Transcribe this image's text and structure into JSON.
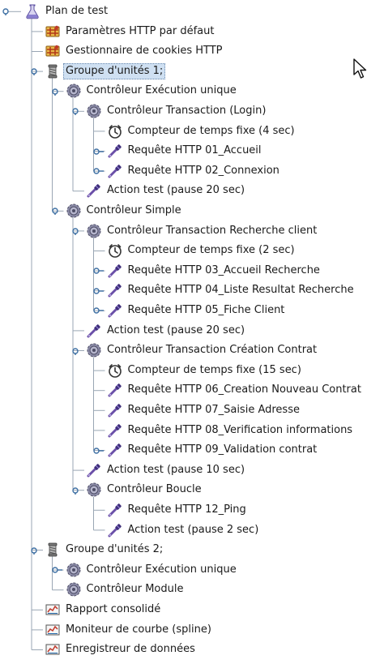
{
  "tree": {
    "nodes": [
      {
        "label": "Plan de test",
        "icon": "flask-icon",
        "depth": 0,
        "handle": "expanded",
        "name": "tree-node-test-plan"
      },
      {
        "label": "Paramètres HTTP par défaut",
        "icon": "config-element-icon",
        "depth": 1,
        "handle": "none",
        "name": "tree-node-http-defaults"
      },
      {
        "label": "Gestionnaire de cookies HTTP",
        "icon": "config-element-icon",
        "depth": 1,
        "handle": "none",
        "name": "tree-node-cookie-manager"
      },
      {
        "label": "Groupe d'unités 1;",
        "icon": "thread-group-icon",
        "depth": 1,
        "handle": "expanded",
        "name": "tree-node-thread-group-1",
        "selected": true
      },
      {
        "label": "Contrôleur Exécution unique",
        "icon": "controller-gear-icon",
        "depth": 2,
        "handle": "expanded",
        "name": "tree-node-once-only-controller"
      },
      {
        "label": "Contrôleur Transaction (Login)",
        "icon": "controller-gear-icon",
        "depth": 3,
        "handle": "expanded",
        "name": "tree-node-transaction-login"
      },
      {
        "label": "Compteur de temps fixe (4 sec)",
        "icon": "timer-icon",
        "depth": 4,
        "handle": "none",
        "name": "tree-node-timer-4s"
      },
      {
        "label": "Requête HTTP 01_Accueil",
        "icon": "pipette-icon",
        "depth": 4,
        "handle": "collapsed",
        "name": "tree-node-request-01"
      },
      {
        "label": "Requête HTTP 02_Connexion",
        "icon": "pipette-icon",
        "depth": 4,
        "handle": "collapsed",
        "name": "tree-node-request-02"
      },
      {
        "label": "Action test (pause 20 sec)",
        "icon": "pipette-icon",
        "depth": 3,
        "handle": "none",
        "name": "tree-node-action-pause-20-a"
      },
      {
        "label": "Contrôleur Simple",
        "icon": "controller-gear-icon",
        "depth": 2,
        "handle": "expanded",
        "name": "tree-node-simple-controller"
      },
      {
        "label": "Contrôleur Transaction Recherche client",
        "icon": "controller-gear-icon",
        "depth": 3,
        "handle": "expanded",
        "name": "tree-node-transaction-search"
      },
      {
        "label": "Compteur de temps fixe (2 sec)",
        "icon": "timer-icon",
        "depth": 4,
        "handle": "none",
        "name": "tree-node-timer-2s"
      },
      {
        "label": "Requête HTTP 03_Accueil Recherche",
        "icon": "pipette-icon",
        "depth": 4,
        "handle": "collapsed",
        "name": "tree-node-request-03"
      },
      {
        "label": "Requête HTTP 04_Liste Resultat Recherche",
        "icon": "pipette-icon",
        "depth": 4,
        "handle": "collapsed",
        "name": "tree-node-request-04"
      },
      {
        "label": "Requête HTTP 05_Fiche Client",
        "icon": "pipette-icon",
        "depth": 4,
        "handle": "collapsed",
        "name": "tree-node-request-05"
      },
      {
        "label": "Action test (pause 20 sec)",
        "icon": "pipette-icon",
        "depth": 3,
        "handle": "none",
        "name": "tree-node-action-pause-20-b"
      },
      {
        "label": "Contrôleur Transaction Création Contrat",
        "icon": "controller-gear-icon",
        "depth": 3,
        "handle": "expanded",
        "name": "tree-node-transaction-contract"
      },
      {
        "label": "Compteur de temps fixe (15 sec)",
        "icon": "timer-icon",
        "depth": 4,
        "handle": "none",
        "name": "tree-node-timer-15s"
      },
      {
        "label": "Requête HTTP 06_Creation Nouveau Contrat",
        "icon": "pipette-icon",
        "depth": 4,
        "handle": "none",
        "name": "tree-node-request-06"
      },
      {
        "label": "Requête HTTP 07_Saisie Adresse",
        "icon": "pipette-icon",
        "depth": 4,
        "handle": "none",
        "name": "tree-node-request-07"
      },
      {
        "label": "Requête HTTP 08_Verification informations",
        "icon": "pipette-icon",
        "depth": 4,
        "handle": "none",
        "name": "tree-node-request-08"
      },
      {
        "label": "Requête HTTP 09_Validation contrat",
        "icon": "pipette-icon",
        "depth": 4,
        "handle": "collapsed",
        "name": "tree-node-request-09"
      },
      {
        "label": "Action test (pause 10 sec)",
        "icon": "pipette-icon",
        "depth": 3,
        "handle": "none",
        "name": "tree-node-action-pause-10"
      },
      {
        "label": "Contrôleur Boucle",
        "icon": "controller-gear-icon",
        "depth": 3,
        "handle": "expanded",
        "name": "tree-node-loop-controller"
      },
      {
        "label": "Requête HTTP 12_Ping",
        "icon": "pipette-icon",
        "depth": 4,
        "handle": "none",
        "name": "tree-node-request-12"
      },
      {
        "label": "Action test (pause 2 sec)",
        "icon": "pipette-icon",
        "depth": 4,
        "handle": "none",
        "name": "tree-node-action-pause-2"
      },
      {
        "label": "Groupe d'unités 2;",
        "icon": "thread-group-icon",
        "depth": 1,
        "handle": "expanded",
        "name": "tree-node-thread-group-2"
      },
      {
        "label": "Contrôleur Exécution unique",
        "icon": "controller-gear-icon",
        "depth": 2,
        "handle": "collapsed",
        "name": "tree-node-once-only-controller-2"
      },
      {
        "label": "Contrôleur Module",
        "icon": "controller-gear-icon",
        "depth": 2,
        "handle": "none",
        "name": "tree-node-module-controller"
      },
      {
        "label": "Rapport consolidé",
        "icon": "listener-graph-icon",
        "depth": 1,
        "handle": "none",
        "name": "tree-node-aggregate-report"
      },
      {
        "label": "Moniteur de courbe (spline)",
        "icon": "listener-graph-icon",
        "depth": 1,
        "handle": "none",
        "name": "tree-node-spline-visualizer"
      },
      {
        "label": "Enregistreur de données",
        "icon": "listener-graph-icon",
        "depth": 1,
        "handle": "none",
        "name": "tree-node-data-writer"
      }
    ]
  },
  "colors": {
    "guide_line": "#9aa6b4",
    "handle": "#3d6fa3",
    "selection_bg": "#cfe0f2",
    "gear": "#6c6c86"
  }
}
